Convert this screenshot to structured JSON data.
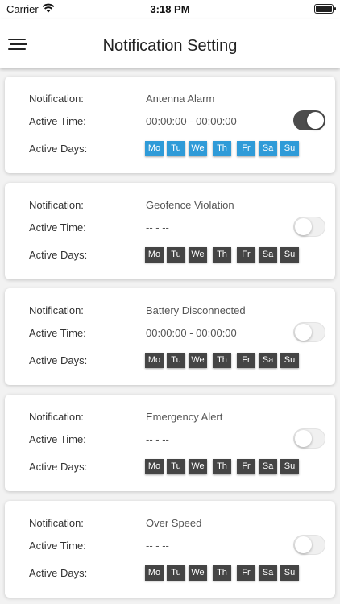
{
  "status_bar": {
    "carrier": "Carrier",
    "time": "3:18 PM"
  },
  "header": {
    "title": "Notification Setting"
  },
  "labels": {
    "notification": "Notification:",
    "active_time": "Active Time:",
    "active_days": "Active Days:"
  },
  "days": [
    "Mo",
    "Tu",
    "We",
    "Th",
    "Fr",
    "Sa",
    "Su"
  ],
  "colors": {
    "active_day": "#2f9bd8",
    "inactive_day": "#454545",
    "toggle_on": "#4c4c4c"
  },
  "notifications": [
    {
      "name": "Antenna Alarm",
      "active_time": "00:00:00 - 00:00:00",
      "enabled": true,
      "days_active": [
        true,
        true,
        true,
        true,
        true,
        true,
        true
      ]
    },
    {
      "name": "Geofence Violation",
      "active_time": "-- - --",
      "enabled": false,
      "days_active": [
        false,
        false,
        false,
        false,
        false,
        false,
        false
      ]
    },
    {
      "name": "Battery Disconnected",
      "active_time": "00:00:00 - 00:00:00",
      "enabled": false,
      "days_active": [
        false,
        false,
        false,
        false,
        false,
        false,
        false
      ]
    },
    {
      "name": "Emergency Alert",
      "active_time": "-- - --",
      "enabled": false,
      "days_active": [
        false,
        false,
        false,
        false,
        false,
        false,
        false
      ]
    },
    {
      "name": "Over Speed",
      "active_time": "-- - --",
      "enabled": false,
      "days_active": [
        false,
        false,
        false,
        false,
        false,
        false,
        false
      ]
    }
  ]
}
